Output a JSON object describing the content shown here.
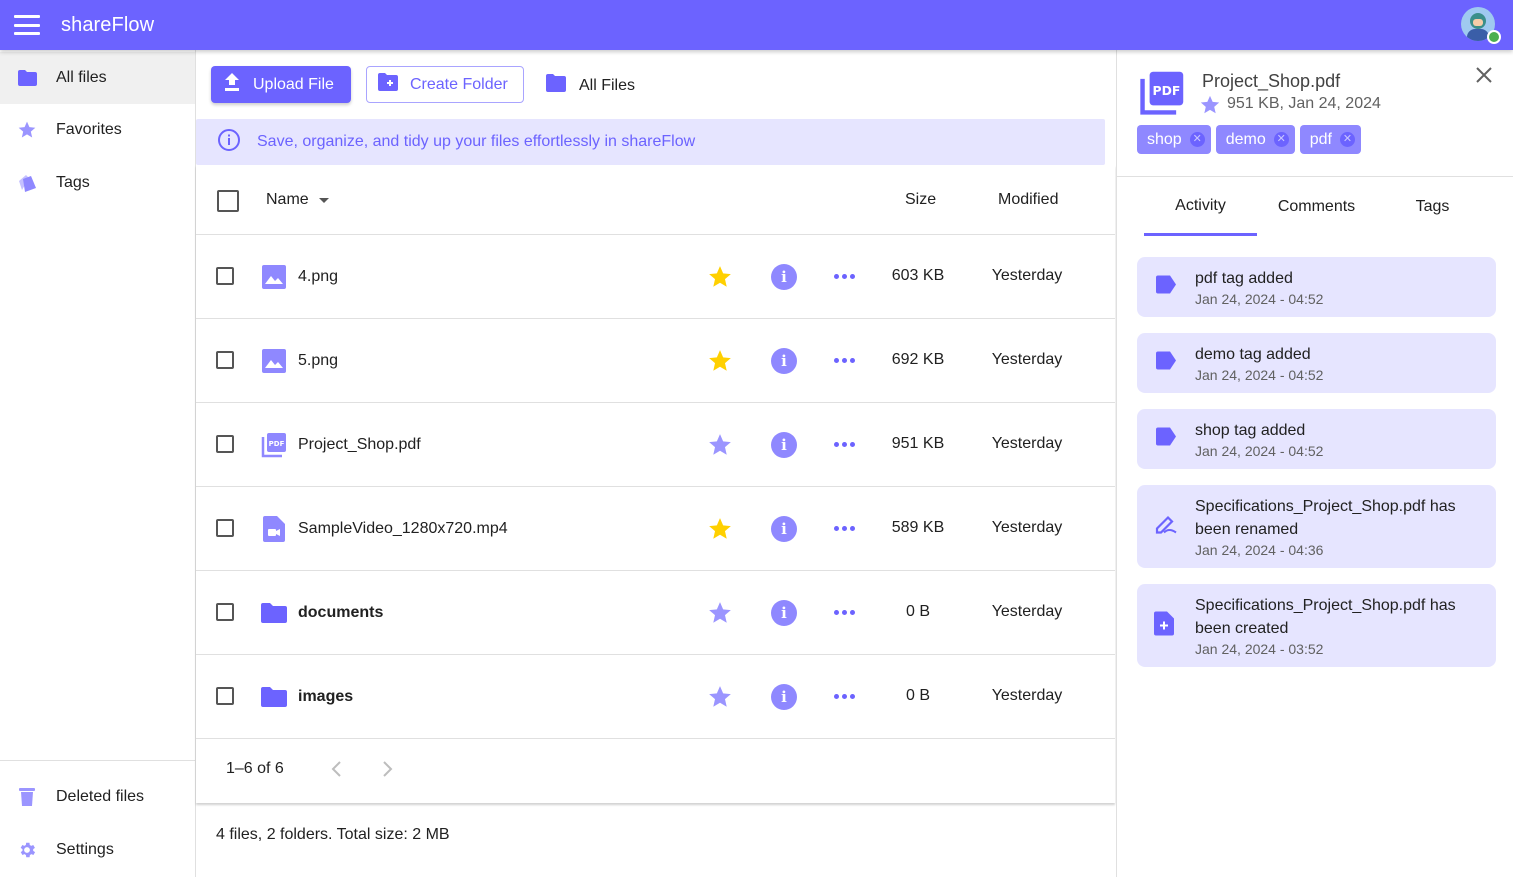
{
  "app": {
    "title": "shareFlow"
  },
  "sidebar": {
    "items": [
      {
        "label": "All files",
        "icon": "folder-icon"
      },
      {
        "label": "Favorites",
        "icon": "star-icon"
      },
      {
        "label": "Tags",
        "icon": "tags-icon"
      }
    ],
    "bottom_items": [
      {
        "label": "Deleted files",
        "icon": "trash-icon"
      },
      {
        "label": "Settings",
        "icon": "gear-icon"
      }
    ]
  },
  "toolbar": {
    "upload_label": "Upload File",
    "create_folder_label": "Create Folder",
    "breadcrumb": "All Files"
  },
  "banner": {
    "text": "Save, organize, and tidy up your files effortlessly in shareFlow"
  },
  "table": {
    "headers": {
      "name": "Name",
      "size": "Size",
      "modified": "Modified"
    },
    "rows": [
      {
        "name": "4.png",
        "type": "image",
        "favorite": true,
        "size": "603 KB",
        "modified": "Yesterday"
      },
      {
        "name": "5.png",
        "type": "image",
        "favorite": true,
        "size": "692 KB",
        "modified": "Yesterday"
      },
      {
        "name": "Project_Shop.pdf",
        "type": "pdf",
        "favorite": false,
        "size": "951 KB",
        "modified": "Yesterday"
      },
      {
        "name": "SampleVideo_1280x720.mp4",
        "type": "video",
        "favorite": true,
        "size": "589 KB",
        "modified": "Yesterday"
      },
      {
        "name": "documents",
        "type": "folder",
        "favorite": false,
        "size": "0 B",
        "modified": "Yesterday"
      },
      {
        "name": "images",
        "type": "folder",
        "favorite": false,
        "size": "0 B",
        "modified": "Yesterday"
      }
    ],
    "pagination": "1–6 of 6"
  },
  "summary": "4 files, 2 folders. Total size: 2 MB",
  "details": {
    "file_name": "Project_Shop.pdf",
    "meta": "951 KB, Jan 24, 2024",
    "tags": [
      "shop",
      "demo",
      "pdf"
    ],
    "tabs": [
      "Activity",
      "Comments",
      "Tags"
    ],
    "activity": [
      {
        "icon": "tag-icon",
        "text": "pdf tag added",
        "date": "Jan 24, 2024 - 04:52"
      },
      {
        "icon": "tag-icon",
        "text": "demo tag added",
        "date": "Jan 24, 2024 - 04:52"
      },
      {
        "icon": "tag-icon",
        "text": "shop tag added",
        "date": "Jan 24, 2024 - 04:52"
      },
      {
        "icon": "rename-icon",
        "text": "Specifications_Project_Shop.pdf has been renamed",
        "date": "Jan 24, 2024 - 04:36"
      },
      {
        "icon": "file-add-icon",
        "text": "Specifications_Project_Shop.pdf has been created",
        "date": "Jan 24, 2024 - 03:52"
      }
    ]
  },
  "colors": {
    "accent": "#6c63ff",
    "accent_light": "#8f88ff",
    "banner_bg": "#e6e5ff",
    "star_fav": "#ffd000",
    "star_off": "#9b95ff"
  }
}
